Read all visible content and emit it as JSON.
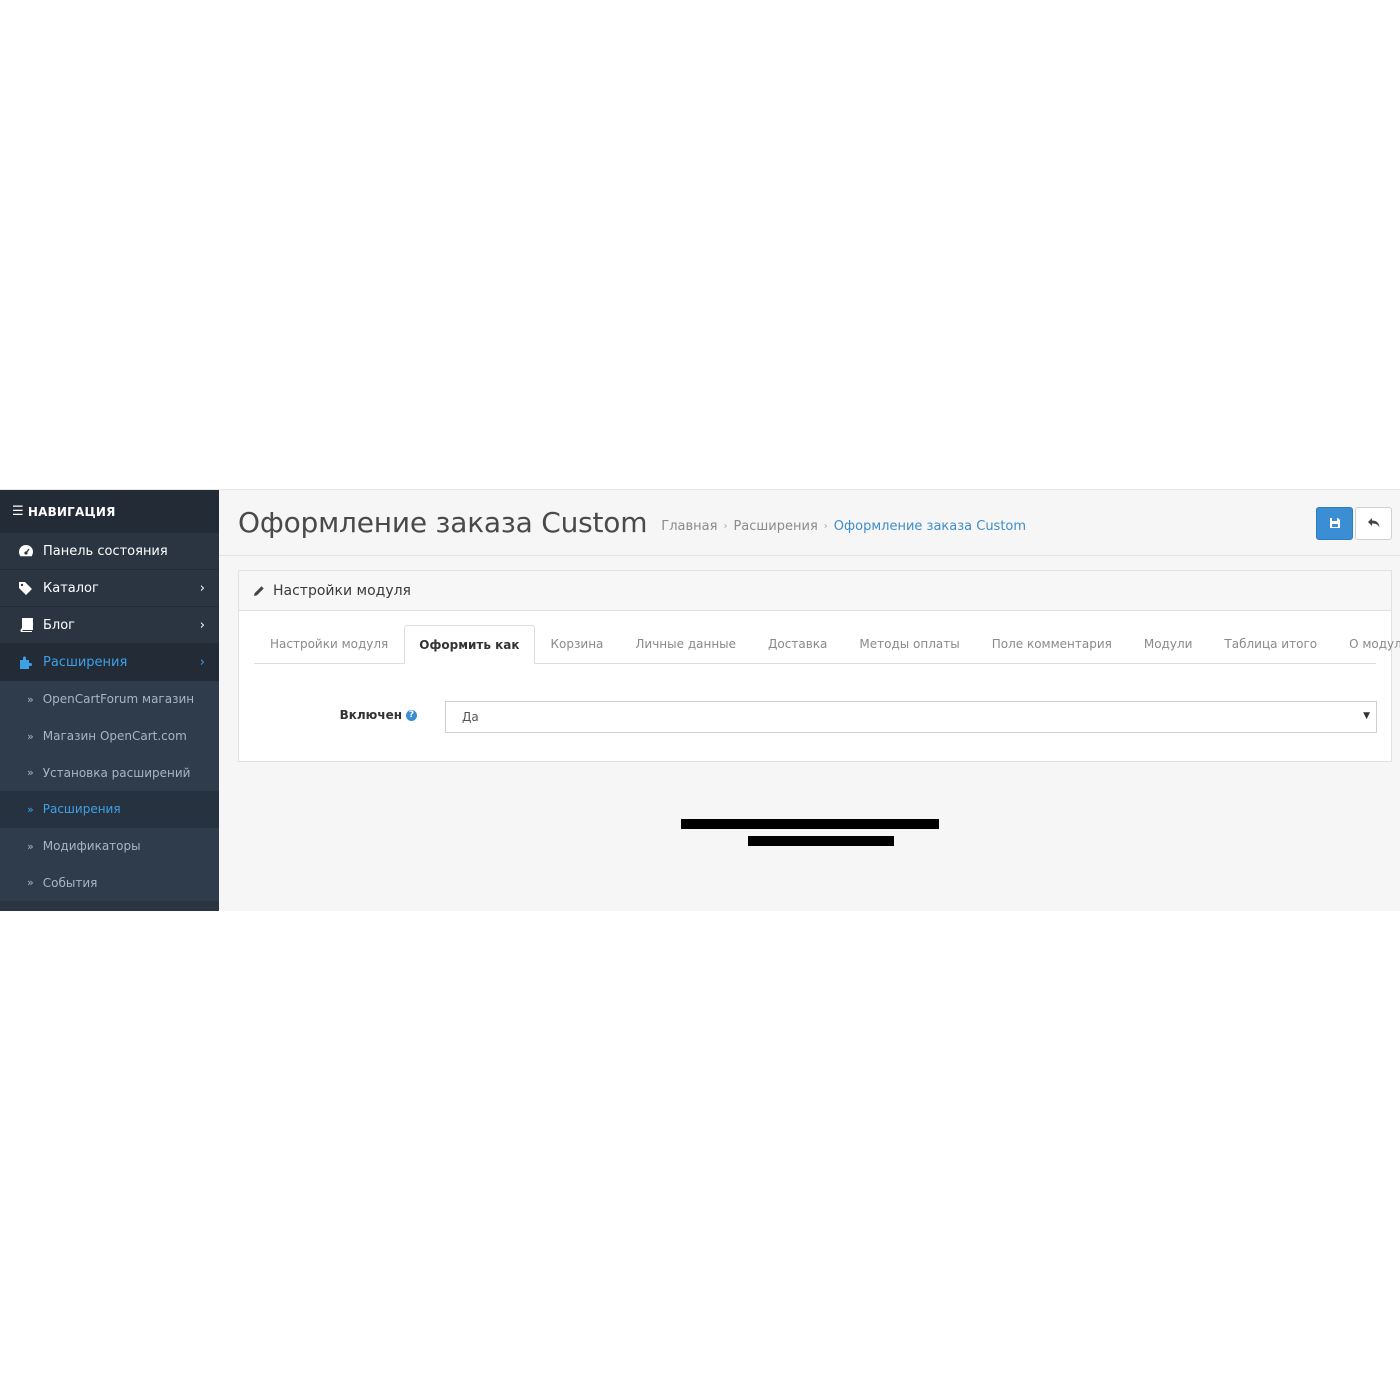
{
  "sidebar": {
    "header": "НАВИГАЦИЯ",
    "items": [
      {
        "label": "Панель состояния",
        "icon": "dashboard-icon"
      },
      {
        "label": "Каталог",
        "icon": "tags-icon"
      },
      {
        "label": "Блог",
        "icon": "book-icon"
      },
      {
        "label": "Расширения",
        "icon": "puzzle-icon"
      }
    ],
    "submenu": [
      {
        "label": "OpenCartForum магазин"
      },
      {
        "label": "Магазин OpenCart.com"
      },
      {
        "label": "Установка расширений"
      },
      {
        "label": "Расширения"
      },
      {
        "label": "Модификаторы"
      },
      {
        "label": "События"
      }
    ]
  },
  "header": {
    "title": "Оформление заказа Custom",
    "breadcrumb": [
      "Главная",
      "Расширения",
      "Оформление заказа Custom"
    ],
    "save_icon": "floppy-icon",
    "back_icon": "reply-icon"
  },
  "panel": {
    "title": "Настройки модуля",
    "tabs": [
      "Настройки модуля",
      "Оформить как",
      "Корзина",
      "Личные данные",
      "Доставка",
      "Методы оплаты",
      "Поле комментария",
      "Модули",
      "Таблица итого",
      "О модуле"
    ],
    "active_tab": "Оформить как",
    "field": {
      "label": "Включен",
      "value": "Да"
    }
  },
  "colors": {
    "sidebar_bg": "#2b3542",
    "accent": "#3ea1e6",
    "primary_button": "#3b8ed4"
  }
}
